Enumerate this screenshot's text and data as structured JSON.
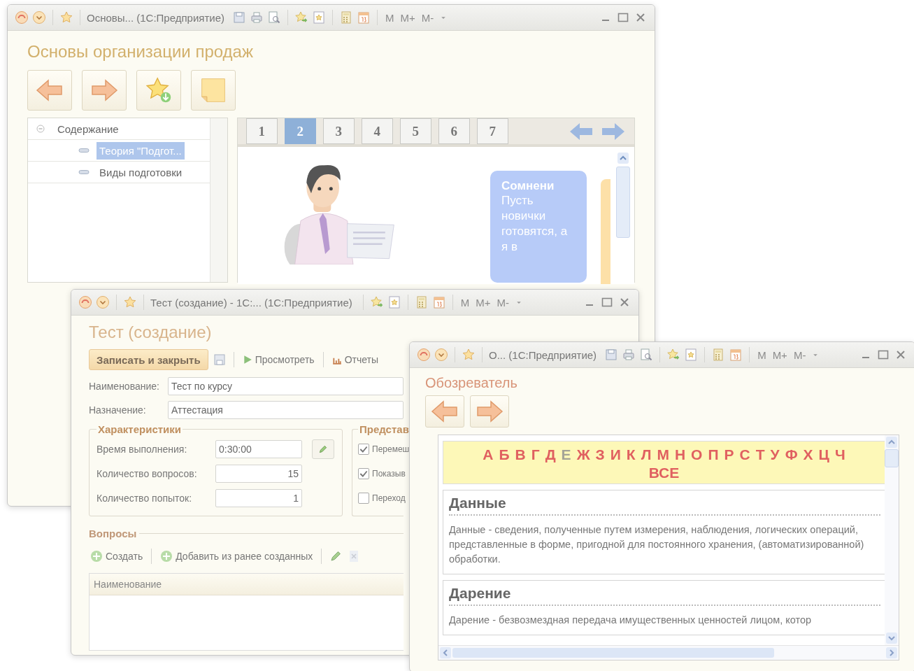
{
  "main_window": {
    "title": "Основы...  (1С:Предприятие)",
    "memory_buttons": [
      "M",
      "M+",
      "M-"
    ],
    "heading": "Основы организации продаж",
    "tree": [
      {
        "label": "Содержание",
        "expanded": true,
        "selected": false,
        "children": [
          {
            "label": "Теория \"Подгот...",
            "selected": true
          },
          {
            "label": "Виды подготовки",
            "selected": false
          }
        ]
      }
    ],
    "pages": [
      {
        "label": "1",
        "selected": false
      },
      {
        "label": "2",
        "selected": true
      },
      {
        "label": "3",
        "selected": false
      },
      {
        "label": "4",
        "selected": false
      },
      {
        "label": "5",
        "selected": false
      },
      {
        "label": "6",
        "selected": false
      },
      {
        "label": "7",
        "selected": false
      }
    ],
    "callout": {
      "title": "Сомнени",
      "text": "Пусть новички готовятся, а я в"
    }
  },
  "test_window": {
    "title": "Тест (создание) - 1С:...  (1С:Предприятие)",
    "memory_buttons": [
      "M",
      "M+",
      "M-"
    ],
    "heading": "Тест (создание)",
    "toolbar": {
      "save_close": "Записать и закрыть",
      "view": "Просмотреть",
      "reports": "Отчеты"
    },
    "fields": [
      {
        "label": "Наименование:",
        "value": "Тест по курсу"
      },
      {
        "label": "Назначение:",
        "value": "Аттестация"
      }
    ],
    "characteristics": {
      "title": "Характеристики",
      "fields": [
        {
          "label": "Время выполнения:",
          "value": "0:30:00",
          "kind": "time"
        },
        {
          "label": "Количество вопросов:",
          "value": "15",
          "kind": "number"
        },
        {
          "label": "Количество попыток:",
          "value": "1",
          "kind": "number"
        }
      ]
    },
    "presentation": {
      "title": "Представ",
      "options": [
        {
          "label": "Перемеш",
          "checked": true
        },
        {
          "label": "Показыв",
          "checked": true
        },
        {
          "label": "Переход",
          "checked": false
        }
      ]
    },
    "questions": {
      "title": "Вопросы",
      "create": "Создать",
      "add_existing": "Добавить из ранее созданных",
      "columns": [
        "Наименование"
      ]
    }
  },
  "browser_window": {
    "title": "О...  (1С:Предприятие)",
    "memory_buttons": [
      "M",
      "M+",
      "M-"
    ],
    "heading": "Обозреватель",
    "letters": [
      {
        "label": "А",
        "disabled": false
      },
      {
        "label": "Б",
        "disabled": false
      },
      {
        "label": "В",
        "disabled": false
      },
      {
        "label": "Г",
        "disabled": false
      },
      {
        "label": "Д",
        "disabled": false
      },
      {
        "label": "Е",
        "disabled": true
      },
      {
        "label": "Ж",
        "disabled": false
      },
      {
        "label": "З",
        "disabled": false
      },
      {
        "label": "И",
        "disabled": false
      },
      {
        "label": "К",
        "disabled": false
      },
      {
        "label": "Л",
        "disabled": false
      },
      {
        "label": "М",
        "disabled": false
      },
      {
        "label": "Н",
        "disabled": false
      },
      {
        "label": "О",
        "disabled": false
      },
      {
        "label": "П",
        "disabled": false
      },
      {
        "label": "Р",
        "disabled": false
      },
      {
        "label": "С",
        "disabled": false
      },
      {
        "label": "Т",
        "disabled": false
      },
      {
        "label": "У",
        "disabled": false
      },
      {
        "label": "Ф",
        "disabled": false
      },
      {
        "label": "Х",
        "disabled": false
      },
      {
        "label": "Ц",
        "disabled": false
      },
      {
        "label": "Ч",
        "disabled": false
      }
    ],
    "all_label": "ВСЕ",
    "articles": [
      {
        "term": "Данные",
        "definition": "Данные - сведения, полученные путем измерения, наблюдения, логических операций, представленные в форме, пригодной для постоянного хранения, (автоматизированной) обработки."
      },
      {
        "term": "Дарение",
        "definition": "Дарение - безвозмездная передача имущественных ценностей лицом, котор"
      }
    ]
  }
}
